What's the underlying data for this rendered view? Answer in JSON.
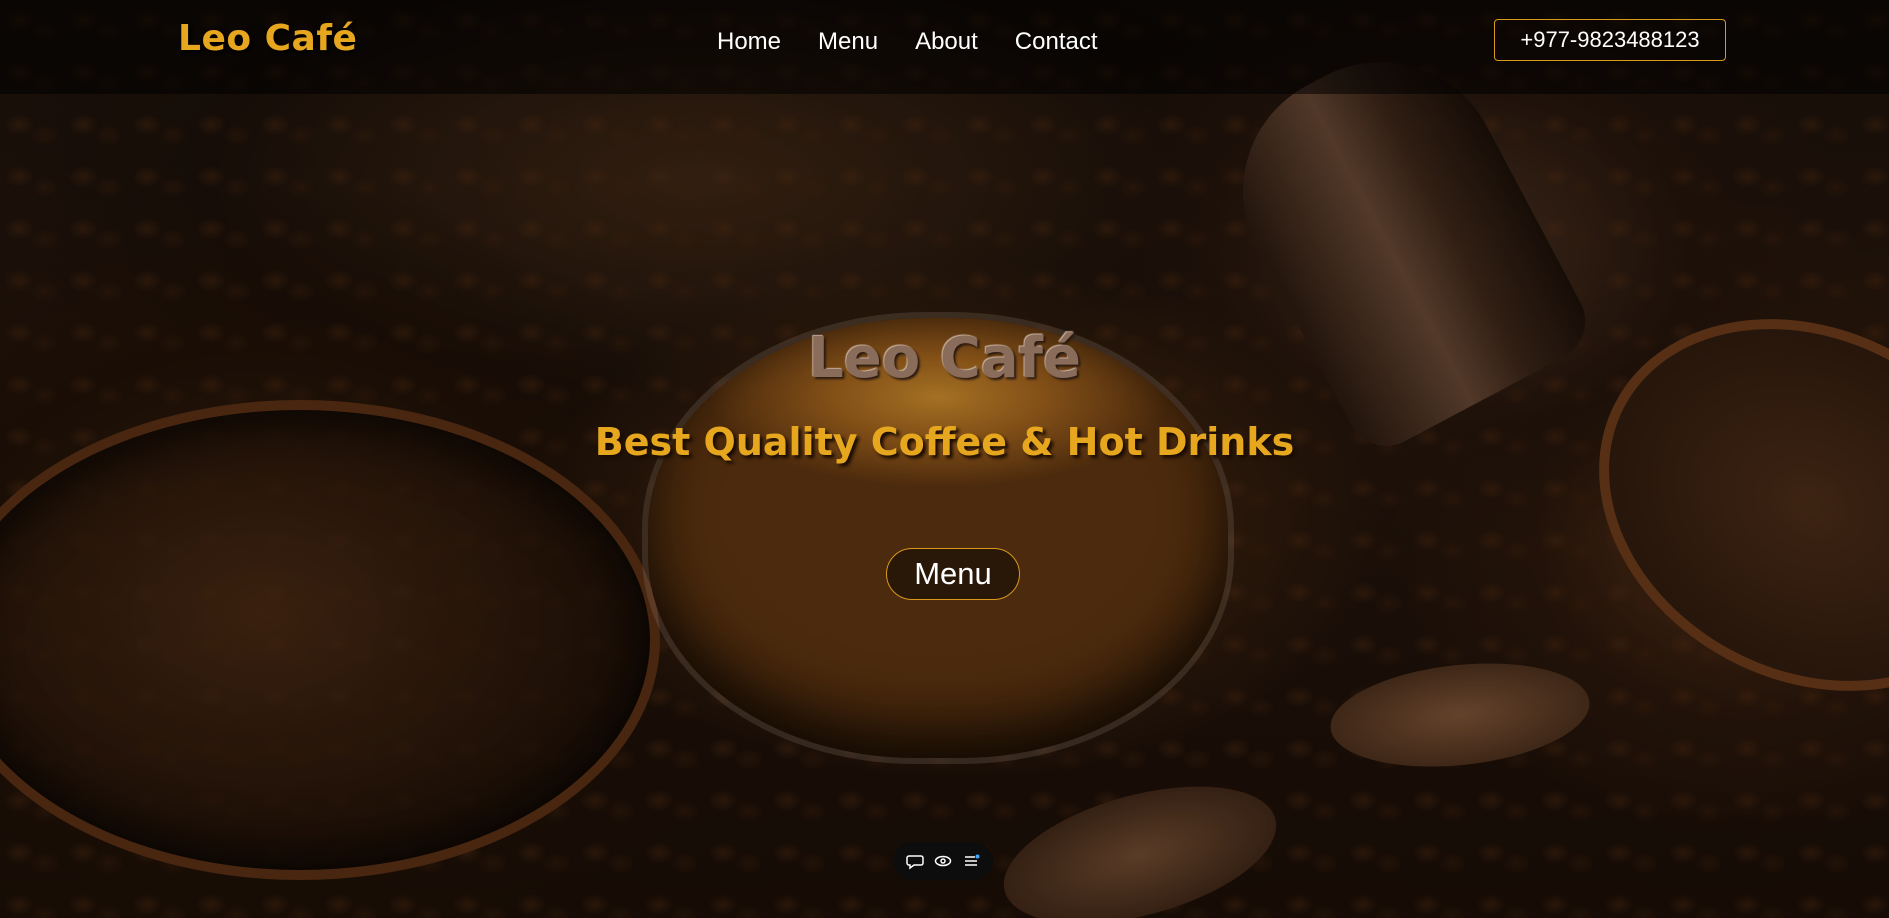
{
  "brand": {
    "name": "Leo Café"
  },
  "nav": {
    "links": [
      {
        "label": "Home"
      },
      {
        "label": "Menu"
      },
      {
        "label": "About"
      },
      {
        "label": "Contact"
      }
    ],
    "phone": "+977-9823488123"
  },
  "hero": {
    "title": "Leo Café",
    "subtitle": "Best Quality Coffee & Hot Drinks",
    "cta_label": "Menu"
  },
  "toolbar": {
    "icons": [
      "chat-bubble-icon",
      "eye-icon",
      "list-menu-icon"
    ]
  },
  "colors": {
    "accent": "#e6a71e",
    "border_accent": "#d99a1c",
    "nav_text": "#ffffff"
  }
}
